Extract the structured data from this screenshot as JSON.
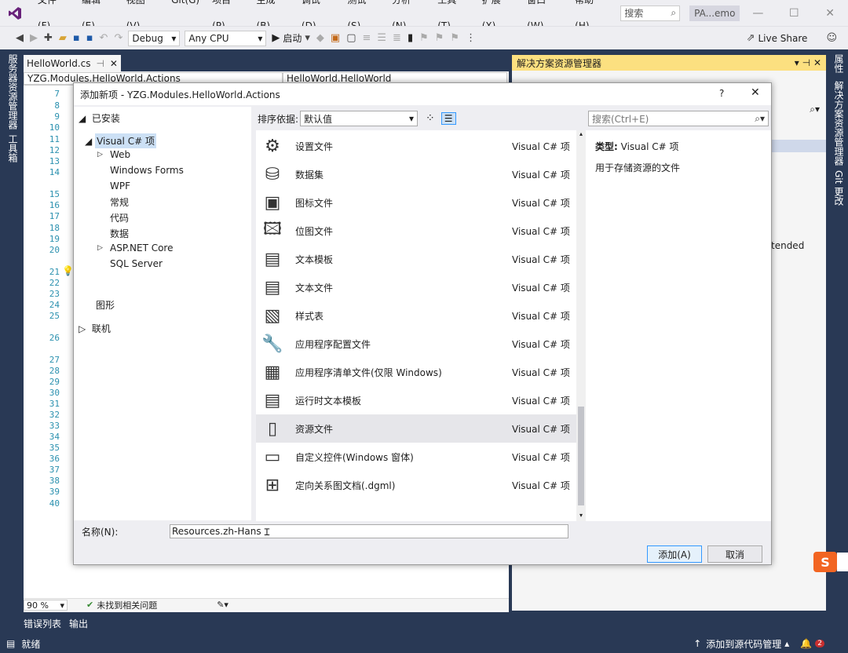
{
  "menu": [
    "文件(F)",
    "编辑(E)",
    "视图(V)",
    "Git(G)",
    "项目(P)",
    "生成(B)",
    "调试(D)",
    "测试(S)",
    "分析(N)",
    "工具(T)",
    "扩展(X)",
    "窗口(W)",
    "帮助(H)"
  ],
  "search_placeholder": "搜索",
  "project_name": "PA...emo",
  "toolbar": {
    "config": "Debug",
    "platform": "Any CPU",
    "start": "启动",
    "live_share": "Live Share"
  },
  "left_strip": [
    "服务器资源管理器",
    "工具箱"
  ],
  "right_strip": [
    "属性",
    "解决方案资源管理器",
    "Git 更改"
  ],
  "editor": {
    "tab": "HelloWorld.cs",
    "nav_left": "YZG.Modules.HelloWorld.Actions",
    "nav_right": "HelloWorld.HelloWorld",
    "line_numbers": [
      "7",
      "8",
      "9",
      "10",
      "11",
      "12",
      "13",
      "14",
      "15",
      "16",
      "17",
      "18",
      "19",
      "20",
      "21",
      "22",
      "23",
      "24",
      "25",
      "26",
      "27",
      "28",
      "29",
      "30",
      "31",
      "32",
      "33",
      "34",
      "35",
      "36",
      "37",
      "38",
      "39",
      "40"
    ],
    "zoom": "90 %",
    "issues": "未找到相关问题"
  },
  "bottom_tabs": [
    "错误列表",
    "输出"
  ],
  "status": {
    "left": "就绪",
    "right": "添加到源代码管理",
    "badge": "2"
  },
  "solution_explorer": {
    "title": "解决方案资源管理器",
    "partial_text": "tended"
  },
  "dialog": {
    "title": "添加新项 - YZG.Modules.HelloWorld.Actions",
    "help": "?",
    "installed": "已安装",
    "tree": {
      "root": "Visual C# 项",
      "children": [
        "Web",
        "Windows Forms",
        "WPF",
        "常规",
        "代码",
        "数据",
        "ASP.NET Core",
        "SQL Server"
      ],
      "graphics": "图形",
      "online": "联机"
    },
    "sort_label": "排序依据:",
    "sort_value": "默认值",
    "search_placeholder": "搜索(Ctrl+E)",
    "items": [
      {
        "name": "设置文件",
        "type": "Visual C# 项",
        "icon": "gear-icon"
      },
      {
        "name": "数据集",
        "type": "Visual C# 项",
        "icon": "dataset-icon"
      },
      {
        "name": "图标文件",
        "type": "Visual C# 项",
        "icon": "icon-file-icon"
      },
      {
        "name": "位图文件",
        "type": "Visual C# 项",
        "icon": "bitmap-icon"
      },
      {
        "name": "文本模板",
        "type": "Visual C# 项",
        "icon": "text-template-icon"
      },
      {
        "name": "文本文件",
        "type": "Visual C# 项",
        "icon": "text-file-icon"
      },
      {
        "name": "样式表",
        "type": "Visual C# 项",
        "icon": "stylesheet-icon"
      },
      {
        "name": "应用程序配置文件",
        "type": "Visual C# 项",
        "icon": "config-icon"
      },
      {
        "name": "应用程序清单文件(仅限 Windows)",
        "type": "Visual C# 项",
        "icon": "manifest-icon"
      },
      {
        "name": "运行时文本模板",
        "type": "Visual C# 项",
        "icon": "runtime-template-icon"
      },
      {
        "name": "资源文件",
        "type": "Visual C# 项",
        "icon": "resource-file-icon"
      },
      {
        "name": "自定义控件(Windows 窗体)",
        "type": "Visual C# 项",
        "icon": "custom-control-icon"
      },
      {
        "name": "定向关系图文档(.dgml)",
        "type": "Visual C# 项",
        "icon": "dgml-icon"
      }
    ],
    "detail": {
      "type_label": "类型:",
      "type_value": "Visual C# 项",
      "description": "用于存储资源的文件"
    },
    "name_label": "名称(N):",
    "name_value": "Resources.zh-Hans",
    "add_button": "添加(A)",
    "cancel_button": "取消"
  }
}
